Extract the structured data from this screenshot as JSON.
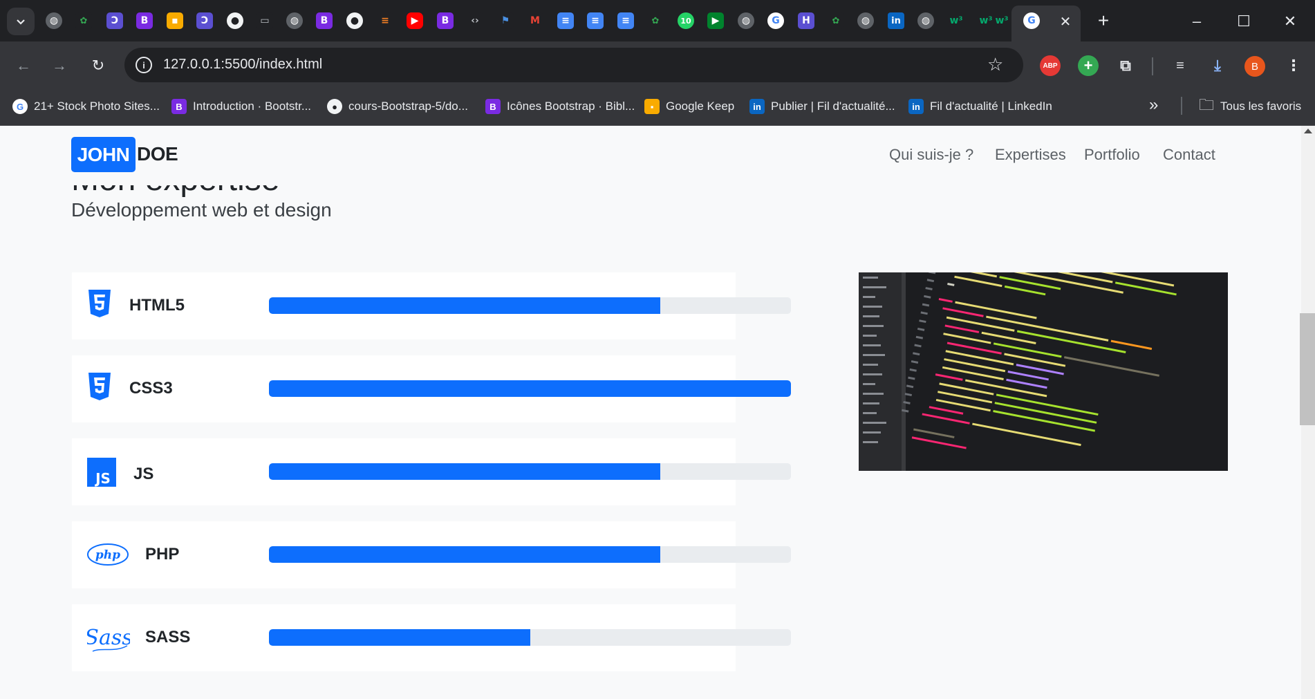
{
  "browser": {
    "url": "127.0.0.1:5500/index.html",
    "profile_initial": "B",
    "tab_icons": [
      "globe-icon",
      "savi-icon",
      "tuxedo-icon",
      "bootstrap-icon",
      "keep-icon",
      "tuxedo-icon",
      "github-icon",
      "window-icon",
      "globe-icon",
      "bootstrap-icon",
      "github-icon",
      "stackoverflow-icon",
      "youtube-icon",
      "bootstrap-icon",
      "code-icon",
      "flag-icon",
      "gmail-icon",
      "docs-icon",
      "docs-icon",
      "docs-icon",
      "savi-icon",
      "whatsapp-icon",
      "meet-icon",
      "globe-icon",
      "google-icon",
      "tuxedo-icon",
      "savi-icon",
      "globe-icon",
      "linkedin-icon",
      "globe-icon",
      "w3schools-icon",
      "w3schools-icon",
      "w3schools-icon",
      "google-icon"
    ],
    "whatsapp_badge": "10",
    "extensions": {
      "abp": "ABP"
    },
    "bookmarks": [
      {
        "label": "21+ Stock Photo Sites...",
        "icon": "google-icon"
      },
      {
        "label": "Introduction · Bootstr...",
        "icon": "bootstrap-icon"
      },
      {
        "label": "cours-Bootstrap-5/do...",
        "icon": "github-icon"
      },
      {
        "label": "Icônes Bootstrap · Bibl...",
        "icon": "bootstrap-icon"
      },
      {
        "label": "Google Keep",
        "icon": "keep-icon"
      },
      {
        "label": "Publier | Fil d'actualité...",
        "icon": "linkedin-icon"
      },
      {
        "label": "Fil d'actualité | LinkedIn",
        "icon": "linkedin-icon"
      }
    ],
    "all_bookmarks_label": "Tous les favoris"
  },
  "site": {
    "brand_first": "JOHN",
    "brand_last": "DOE",
    "nav": [
      "Qui suis-je ?",
      "Expertises",
      "Portfolio",
      "Contact"
    ],
    "section_title": "Mon expertise",
    "section_subtitle": "Développement web et design",
    "accent_color": "#0d6efd",
    "skills": [
      {
        "name": "HTML5",
        "icon": "html5-icon",
        "level": 0.75
      },
      {
        "name": "CSS3",
        "icon": "css3-icon",
        "level": 1.0
      },
      {
        "name": "JS",
        "icon": "js-icon",
        "level": 0.75
      },
      {
        "name": "PHP",
        "icon": "php-icon",
        "level": 0.75
      },
      {
        "name": "SASS",
        "icon": "sass-icon",
        "level": 0.5
      }
    ]
  }
}
